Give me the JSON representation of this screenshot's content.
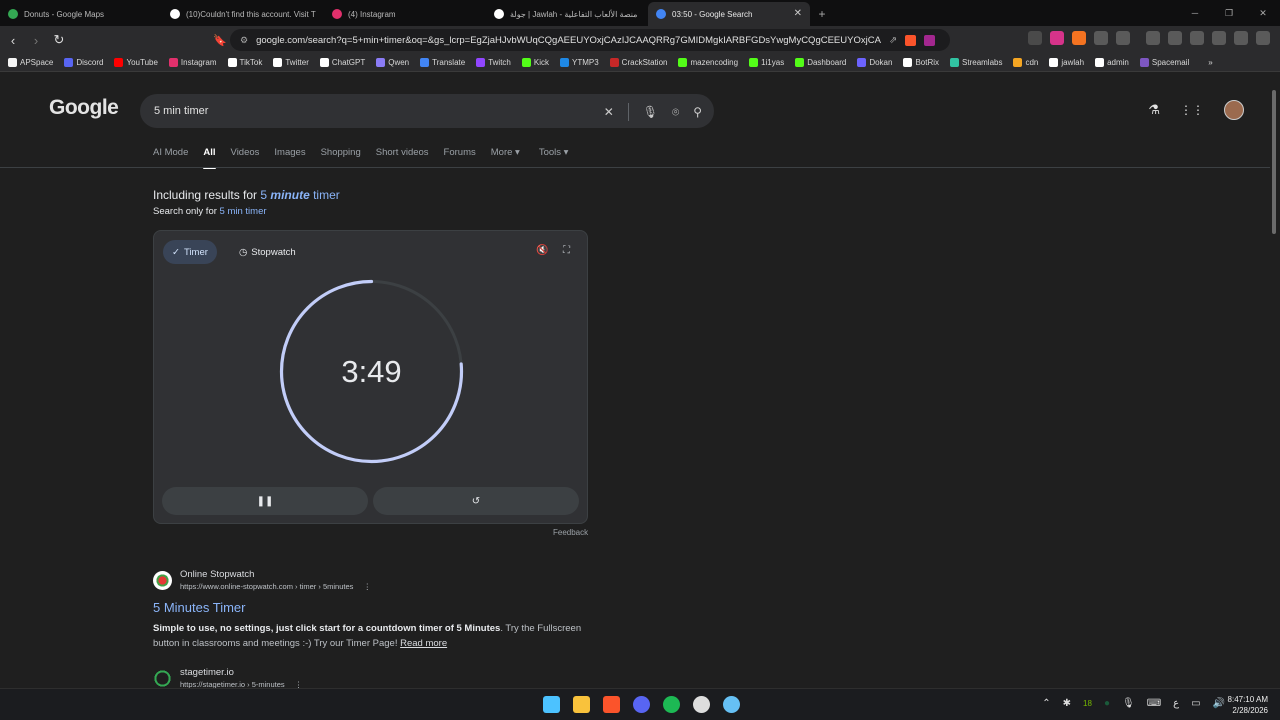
{
  "browser": {
    "tabs": [
      {
        "title": "Donuts - Google Maps",
        "color": "#34a853",
        "active": false
      },
      {
        "title": "(10)Couldn't find this account. Visit T",
        "color": "#ffffff",
        "active": false
      },
      {
        "title": "(4) Instagram",
        "color": "#e1306c",
        "active": false
      },
      {
        "title": "جولة | Jawlah - منصة الألعاب التفاعلية",
        "color": "#ffffff",
        "active": false
      },
      {
        "title": "03:50 - Google Search",
        "color": "#4285f4",
        "active": true
      }
    ],
    "url": "google.com/search?q=5+min+timer&oq=&gs_lcrp=EgZjaHJvbWUqCQgAEEUYOxjCAzIJCAAQRRg7GMIDMgkIARBFGDsYwgMyCQgCEEUYOxjCAzIJCA...",
    "bookmarks": [
      {
        "label": "APSpace",
        "color": "#f5f5f5"
      },
      {
        "label": "Discord",
        "color": "#5865f2"
      },
      {
        "label": "YouTube",
        "color": "#ff0000"
      },
      {
        "label": "Instagram",
        "color": "#e1306c"
      },
      {
        "label": "TikTok",
        "color": "#ffffff"
      },
      {
        "label": "Twitter",
        "color": "#ffffff"
      },
      {
        "label": "ChatGPT",
        "color": "#ffffff"
      },
      {
        "label": "Qwen",
        "color": "#8b7cf6"
      },
      {
        "label": "Translate",
        "color": "#4285f4"
      },
      {
        "label": "Twitch",
        "color": "#9146ff"
      },
      {
        "label": "Kick",
        "color": "#53fc18"
      },
      {
        "label": "YTMP3",
        "color": "#1e88e5"
      },
      {
        "label": "CrackStation",
        "color": "#c62828"
      },
      {
        "label": "mazencoding",
        "color": "#53fc18"
      },
      {
        "label": "1i1yas",
        "color": "#53fc18"
      },
      {
        "label": "Dashboard",
        "color": "#53fc18"
      },
      {
        "label": "Dokan",
        "color": "#6c63ff"
      },
      {
        "label": "BotRix",
        "color": "#ffffff"
      },
      {
        "label": "Streamlabs",
        "color": "#31c3a2"
      },
      {
        "label": "cdn",
        "color": "#f5a623"
      },
      {
        "label": "jawlah",
        "color": "#ffffff"
      },
      {
        "label": "admin",
        "color": "#ffffff"
      },
      {
        "label": "Spacemail",
        "color": "#7e57c2"
      }
    ]
  },
  "google": {
    "logo": "Google",
    "query": "5 min timer",
    "tabs": [
      "AI Mode",
      "All",
      "Videos",
      "Images",
      "Shopping",
      "Short videos",
      "Forums",
      "More ▾",
      "Tools ▾"
    ],
    "including_prefix": "Including results for ",
    "including_q1": "5 ",
    "including_q2": "minute",
    "including_q3": " timer",
    "search_only_prefix": "Search only for ",
    "search_only_link": "5 min timer",
    "timer": {
      "tab_timer": "Timer",
      "tab_stopwatch": "Stopwatch",
      "time": "3:49",
      "remaining_fraction": 0.763,
      "feedback": "Feedback"
    },
    "results": [
      {
        "site": "Online Stopwatch",
        "url": "https://www.online-stopwatch.com › timer › 5minutes",
        "title": "5 Minutes Timer",
        "snippet_bold": "Simple to use, no settings, just click start for a countdown timer of 5 Minutes",
        "snippet_rest": ". Try the Fullscreen button in classrooms and meetings :-) Try our Timer Page! ",
        "read_more": "Read more"
      },
      {
        "site": "stagetimer.io",
        "url": "https://stagetimer.io › 5-minutes"
      }
    ]
  },
  "taskbar": {
    "time": "8:47:10 AM",
    "date": "2/28/2026",
    "lang": "ع"
  }
}
